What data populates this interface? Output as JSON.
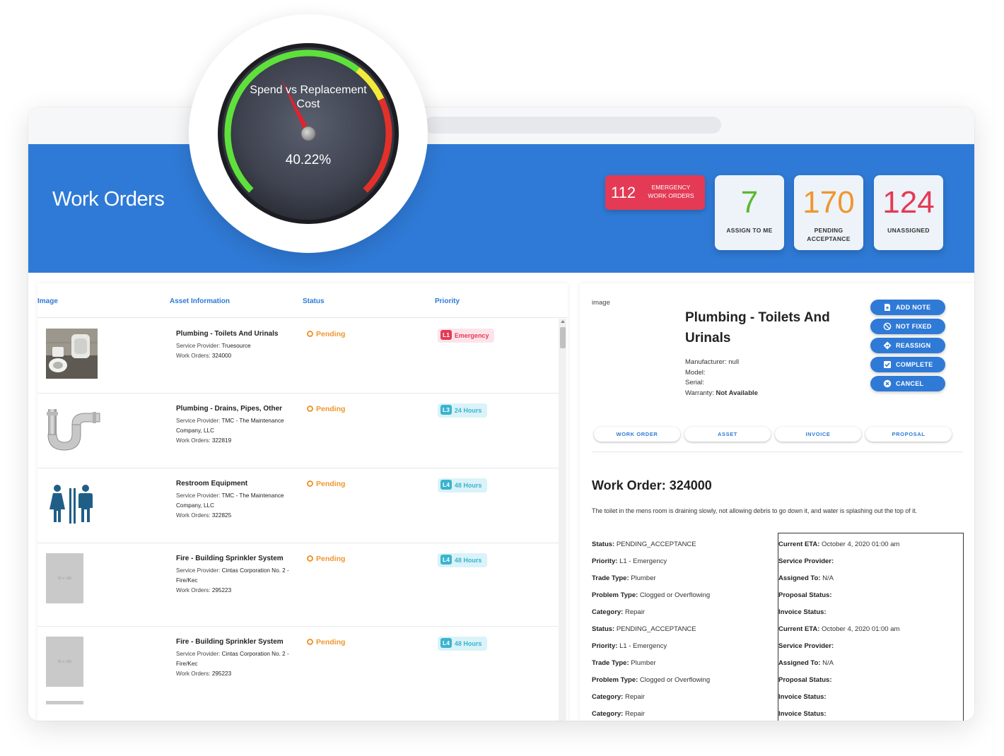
{
  "header": {
    "title": "Work Orders",
    "emergency": {
      "count": "112",
      "label": "EMERGENCY WORK ORDERS"
    },
    "stats": [
      {
        "count": "7",
        "label": "ASSIGN TO ME",
        "color": "#5cb82e"
      },
      {
        "count": "170",
        "label": "PENDING ACCEPTANCE",
        "color": "#f0962e"
      },
      {
        "count": "124",
        "label": "UNASSIGNED",
        "color": "#e43a55"
      }
    ]
  },
  "gauge": {
    "title": "Spend vs Replacement Cost",
    "value_text": "40.22%",
    "value": 40.22,
    "colors": {
      "green": "#5ee13b",
      "yellow": "#f4ea3a",
      "red": "#e1312a"
    }
  },
  "list": {
    "columns": {
      "image": "Image",
      "asset": "Asset Information",
      "status": "Status",
      "priority": "Priority"
    },
    "rows": [
      {
        "title": "Plumbing - Toilets And Urinals",
        "provider_label": "Service Provider:",
        "provider": "Truesource",
        "wo_label": "Work Orders:",
        "wo": "324000",
        "status": "Pending",
        "prio_tag": "L1",
        "prio_text": "Emergency",
        "prio_color": "red",
        "image": "restroom-photo"
      },
      {
        "title": "Plumbing - Drains, Pipes, Other",
        "provider_label": "Service Provider:",
        "provider": "TMC - The Maintenance Company, LLC",
        "wo_label": "Work Orders:",
        "wo": "322819",
        "status": "Pending",
        "prio_tag": "L3",
        "prio_text": "24 Hours",
        "prio_color": "teal",
        "image": "pipe-icon"
      },
      {
        "title": "Restroom Equipment",
        "provider_label": "Service Provider:",
        "provider": "TMC - The Maintenance Company, LLC",
        "wo_label": "Work Orders:",
        "wo": "322825",
        "status": "Pending",
        "prio_tag": "L4",
        "prio_text": "48 Hours",
        "prio_color": "teal",
        "image": "restroom-sign-icon"
      },
      {
        "title": "Fire - Building Sprinkler System",
        "provider_label": "Service Provider:",
        "provider": "Cintas Corporation No. 2 - Fire/Kec",
        "wo_label": "Work Orders:",
        "wo": "295223",
        "status": "Pending",
        "prio_tag": "L4",
        "prio_text": "48 Hours",
        "prio_color": "teal",
        "image": "placeholder"
      },
      {
        "title": "Fire - Building Sprinkler System",
        "provider_label": "Service Provider:",
        "provider": "Cintas Corporation No. 2 - Fire/Kec",
        "wo_label": "Work Orders:",
        "wo": "295223",
        "status": "Pending",
        "prio_tag": "L4",
        "prio_text": "48 Hours",
        "prio_color": "teal",
        "image": "placeholder"
      }
    ],
    "placeholder_text": "91 x 136"
  },
  "detail": {
    "image_label": "image",
    "title": "Plumbing - Toilets And Urinals",
    "manufacturer_label": "Manufacturer:",
    "manufacturer": "null",
    "model_label": "Model:",
    "serial_label": "Serial:",
    "warranty_label": "Warranty:",
    "warranty": "Not Available",
    "actions": [
      "ADD NOTE",
      "NOT FIXED",
      "REASSIGN",
      "COMPLETE",
      "CANCEL"
    ],
    "tabs": [
      "WORK ORDER",
      "ASSET",
      "INVOICE",
      "PROPOSAL"
    ],
    "wo_heading": "Work Order: 324000",
    "description": "The toilet in the mens room is draining slowly, not allowing debris to go down it, and water is splashing out the top of it.",
    "left_fields": [
      {
        "k": "Status:",
        "v": "PENDING_ACCEPTANCE"
      },
      {
        "k": "Priority:",
        "v": "L1 - Emergency"
      },
      {
        "k": "Trade Type:",
        "v": "Plumber"
      },
      {
        "k": "Problem Type:",
        "v": "Clogged or Overflowing"
      },
      {
        "k": "Category:",
        "v": "Repair"
      },
      {
        "k": "Status:",
        "v": "PENDING_ACCEPTANCE"
      },
      {
        "k": "Priority:",
        "v": "L1 - Emergency"
      },
      {
        "k": "Trade Type:",
        "v": "Plumber"
      },
      {
        "k": "Problem Type:",
        "v": "Clogged or Overflowing"
      },
      {
        "k": "Category:",
        "v": "Repair"
      },
      {
        "k": "Category:",
        "v": "Repair"
      }
    ],
    "right_fields": [
      {
        "k": "Current ETA:",
        "v": "October 4, 2020 01:00 am"
      },
      {
        "k": "Service Provider:",
        "v": ""
      },
      {
        "k": "Assigned To:",
        "v": "N/A"
      },
      {
        "k": "Proposal Status:",
        "v": ""
      },
      {
        "k": "Invoice Status:",
        "v": ""
      },
      {
        "k": "Current ETA:",
        "v": "October 4, 2020 01:00 am"
      },
      {
        "k": "Service Provider:",
        "v": ""
      },
      {
        "k": "Assigned To:",
        "v": "N/A"
      },
      {
        "k": "Proposal Status:",
        "v": ""
      },
      {
        "k": "Invoice Status:",
        "v": ""
      },
      {
        "k": "Invoice Status:",
        "v": ""
      }
    ]
  }
}
